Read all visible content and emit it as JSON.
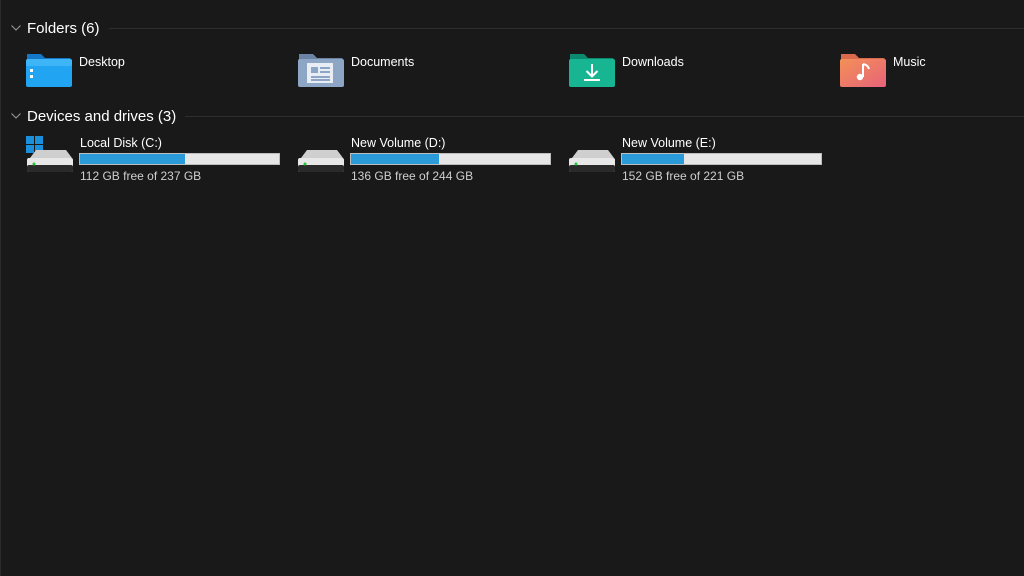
{
  "sections": {
    "folders": {
      "title": "Folders (6)",
      "items": [
        {
          "label": "Desktop",
          "icon": "desktop-folder-icon",
          "color": "#1e9be8"
        },
        {
          "label": "Documents",
          "icon": "documents-folder-icon",
          "color": "#8aa3c4"
        },
        {
          "label": "Downloads",
          "icon": "downloads-folder-icon",
          "color": "#14b08f"
        },
        {
          "label": "Music",
          "icon": "music-folder-icon",
          "color": "#ec7d62"
        }
      ]
    },
    "devices": {
      "title": "Devices and drives (3)",
      "items": [
        {
          "name": "Local Disk (C:)",
          "free_text": "112 GB free of 237 GB",
          "used_fraction": 0.527,
          "icon": "windows-drive-icon"
        },
        {
          "name": "New Volume (D:)",
          "free_text": "136 GB free of 244 GB",
          "used_fraction": 0.443,
          "icon": "drive-icon"
        },
        {
          "name": "New Volume (E:)",
          "free_text": "152 GB free of 221 GB",
          "used_fraction": 0.312,
          "icon": "drive-icon"
        }
      ]
    }
  },
  "colors": {
    "background": "#191919",
    "bar_fill": "#2b9ad9",
    "bar_track": "#e6e6e6"
  }
}
